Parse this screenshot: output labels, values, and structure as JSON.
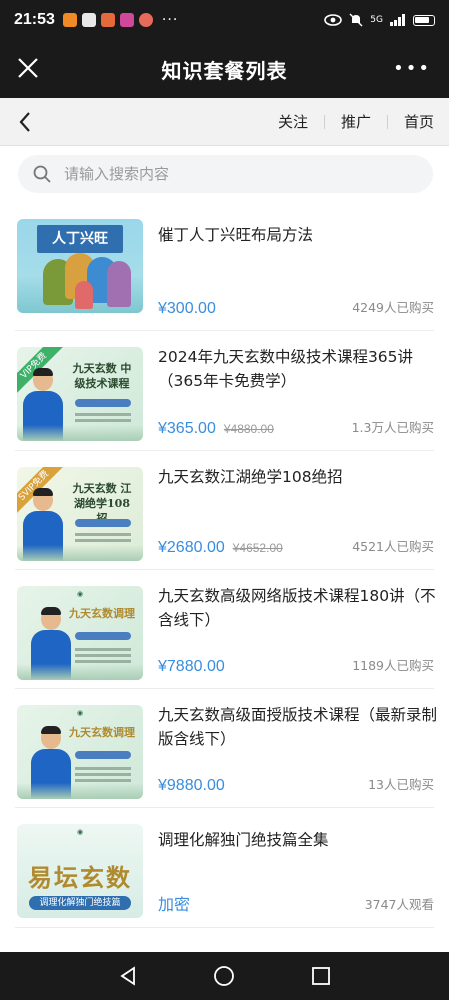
{
  "status_bar": {
    "time": "21:53",
    "more": "···",
    "network": "5G"
  },
  "title_bar": {
    "title": "知识套餐列表",
    "more": "•••"
  },
  "nav": {
    "follow": "关注",
    "promote": "推广",
    "home": "首页"
  },
  "search": {
    "placeholder": "请输入搜索内容"
  },
  "courses": [
    {
      "title": "催丁人丁兴旺布局方法",
      "price": "¥300.00",
      "original_price": "",
      "buyers": "4249人已购买",
      "thumb_text": "人丁兴旺"
    },
    {
      "title": "2024年九天玄数中级技术课程365讲（365年卡免费学）",
      "price": "¥365.00",
      "original_price": "¥4880.00",
      "buyers": "1.3万人已购买",
      "thumb_text": "九天玄数 中级技术课程",
      "ribbon": "VIP免费"
    },
    {
      "title": "九天玄数江湖绝学108绝招",
      "price": "¥2680.00",
      "original_price": "¥4652.00",
      "buyers": "4521人已购买",
      "thumb_text": "九天玄数 江湖绝学108招",
      "ribbon": "SVIP免费"
    },
    {
      "title": "九天玄数高级网络版技术课程180讲（不含线下）",
      "price": "¥7880.00",
      "original_price": "",
      "buyers": "1189人已购买",
      "thumb_text": "九天玄数调理"
    },
    {
      "title": "九天玄数高级面授版技术课程（最新录制版含线下）",
      "price": "¥9880.00",
      "original_price": "",
      "buyers": "13人已购买",
      "thumb_text": "九天玄数调理"
    },
    {
      "title": "调理化解独门绝技篇全集",
      "price": "加密",
      "original_price": "",
      "buyers": "3747人观看",
      "thumb_text": "易坛玄数",
      "thumb_sub": "调理化解独门绝技篇"
    }
  ],
  "colors": {
    "accent": "#3a8dde",
    "dark_bar": "#1a1a1a",
    "nav_bg": "#f2f2f2"
  },
  "icons": {
    "close": "close-icon",
    "more": "more-icon",
    "back": "back-arrow-icon",
    "search": "search-icon",
    "sys_back": "triangle-back-icon",
    "sys_home": "circle-home-icon",
    "sys_recent": "square-recent-icon"
  }
}
